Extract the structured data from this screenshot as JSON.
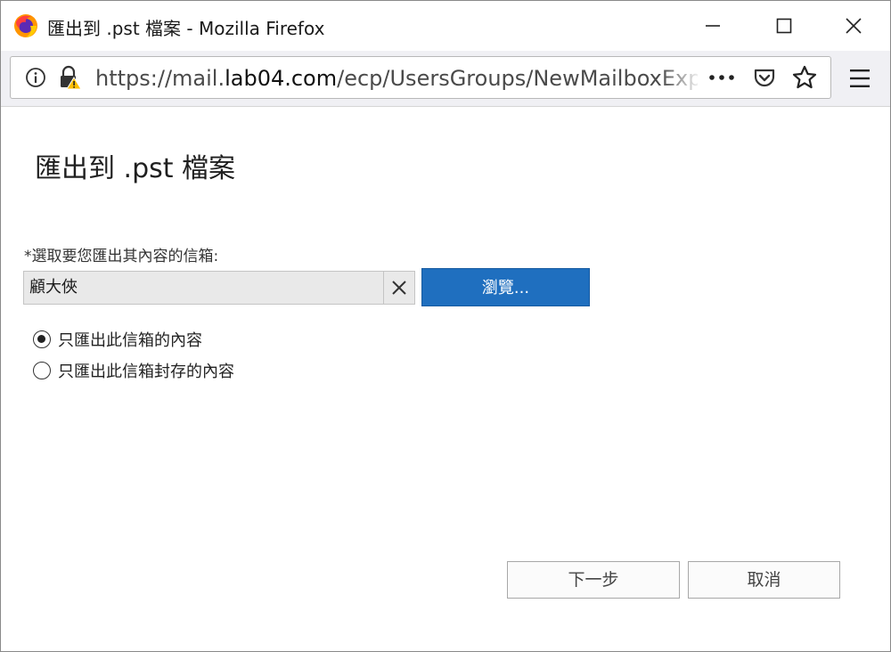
{
  "window": {
    "title": "匯出到 .pst 檔案 - Mozilla Firefox"
  },
  "toolbar": {
    "url_prefix": "https://mail.",
    "url_domain": "lab04.com",
    "url_path": "/ecp/UsersGroups/NewMailboxExpor"
  },
  "icons": {
    "app": "firefox-logo-icon",
    "info": "info-icon",
    "lock": "lock-warning-icon",
    "page_actions": "more-dots-icon",
    "pocket": "pocket-icon",
    "bookmark": "star-icon",
    "menu": "hamburger-menu-icon",
    "clear": "close-icon"
  },
  "dialog": {
    "heading": "匯出到 .pst 檔案",
    "field_label": "*選取要您匯出其內容的信箱:",
    "mailbox_value": "顧大俠",
    "browse_label": "瀏覽...",
    "options": [
      {
        "label": "只匯出此信箱的內容",
        "selected": true
      },
      {
        "label": "只匯出此信箱封存的內容",
        "selected": false
      }
    ],
    "next_label": "下一步",
    "cancel_label": "取消"
  },
  "colors": {
    "accent": "#1f6fbf",
    "toolbar_bg": "#f0f0f4"
  }
}
